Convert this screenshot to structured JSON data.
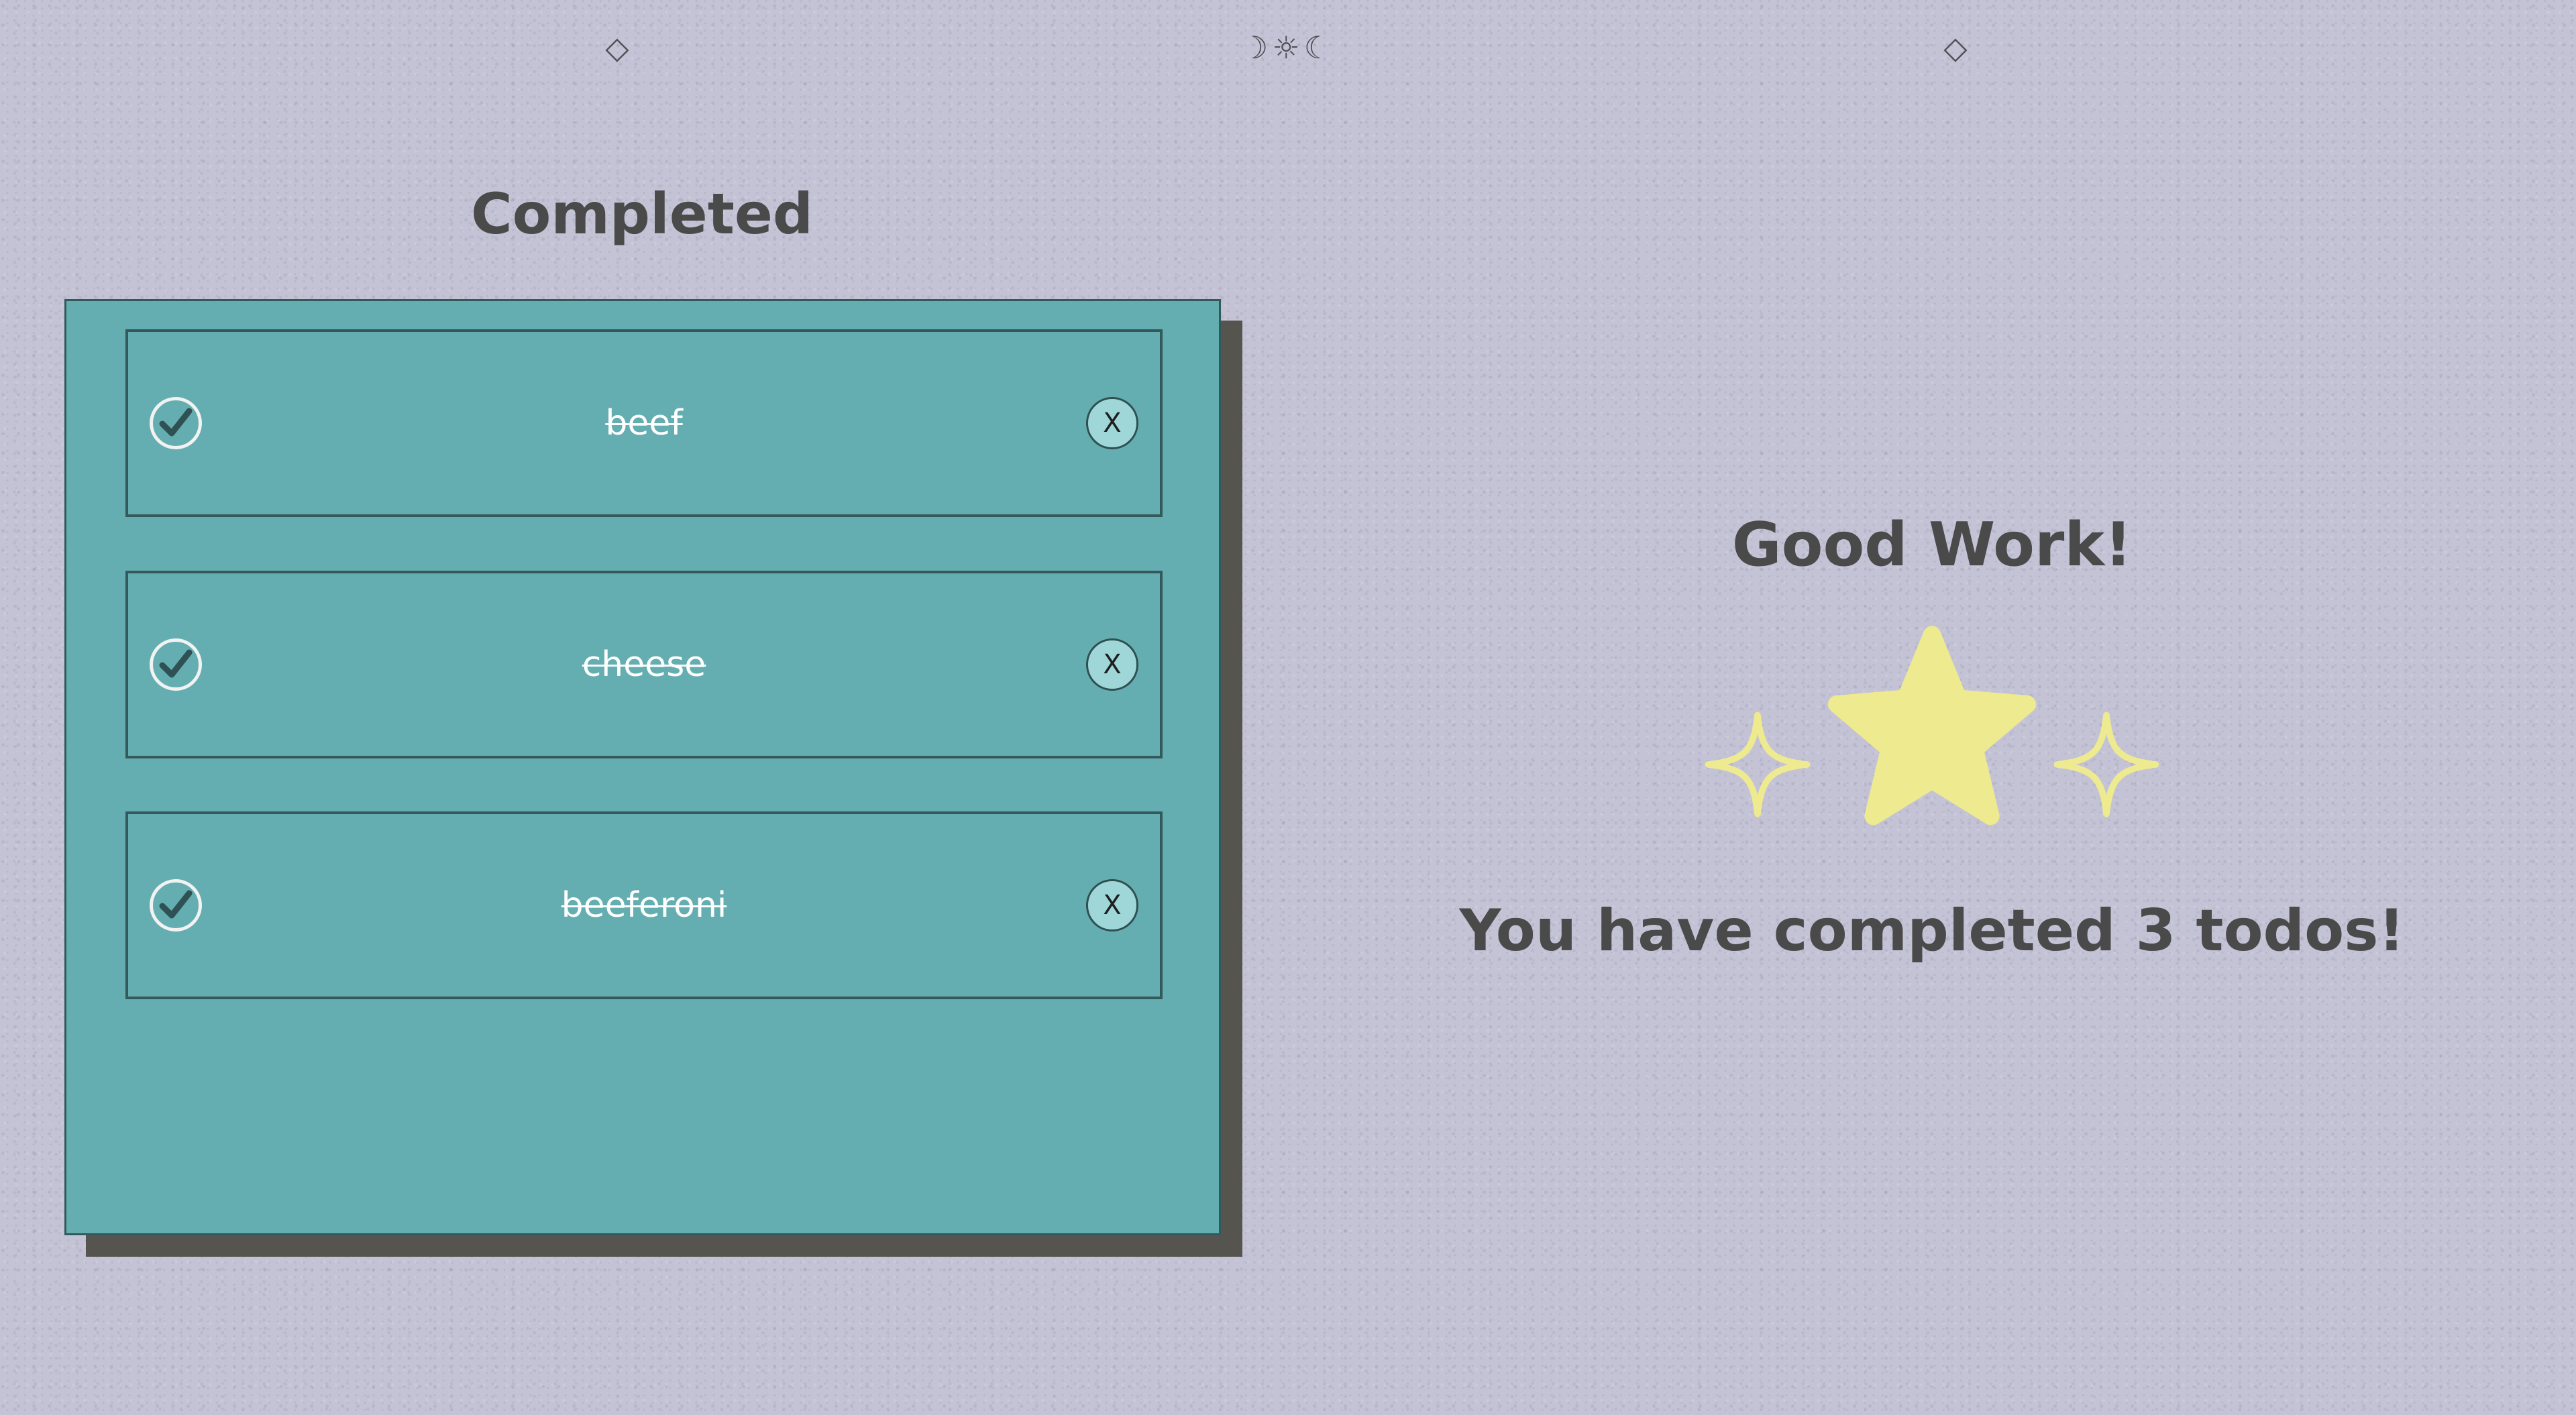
{
  "ornaments": {
    "left": "◇",
    "center": "☽☼☾",
    "right": "◇"
  },
  "completed_section": {
    "title": "Completed",
    "items": [
      {
        "text": "beef",
        "checked": true,
        "delete_label": "X"
      },
      {
        "text": "cheese",
        "checked": true,
        "delete_label": "X"
      },
      {
        "text": "beeferoni",
        "checked": true,
        "delete_label": "X"
      }
    ]
  },
  "summary": {
    "heading": "Good Work!",
    "message": "You have completed 3 todos!"
  },
  "colors": {
    "background": "#c4c3d6",
    "panel": "#64aeb1",
    "panel_shadow": "#55544f",
    "star": "#eeea8f",
    "text_dark": "#4a4a4a"
  }
}
